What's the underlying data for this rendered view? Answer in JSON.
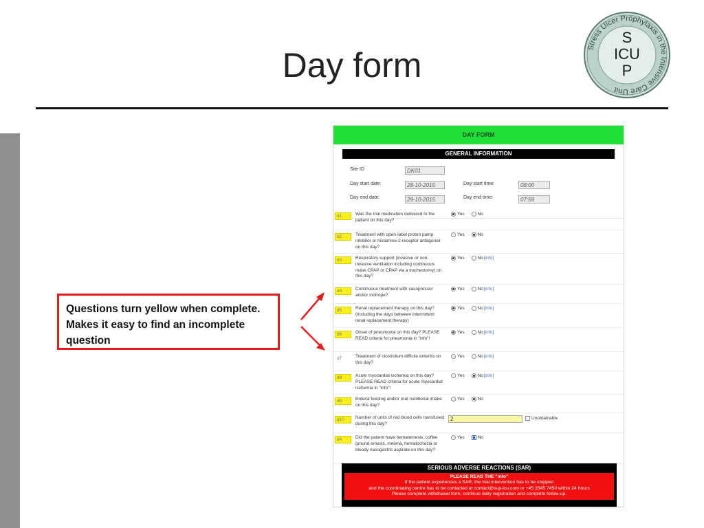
{
  "slide": {
    "title": "Day form",
    "callout": "Questions turn yellow when complete. Makes it easy to find an incomplete question"
  },
  "logo": {
    "ring_text": "Stress Ulcer Prophylaxis in the Intensive Care Unit",
    "letters": [
      "S",
      "ICU",
      "P"
    ]
  },
  "form": {
    "header": "DAY FORM",
    "general_section": "GENERAL INFORMATION",
    "general": {
      "site_id_label": "Site ID",
      "site_id": "DK01",
      "day_start_date_label": "Day start date:",
      "day_start_date": "28-10-2015",
      "day_start_time_label": "Day start time:",
      "day_start_time": "08:00",
      "day_end_date_label": "Day end date:",
      "day_end_date": "29-10-2015",
      "day_end_time_label": "Day end time:",
      "day_end_time": "07:59"
    },
    "yes_label": "Yes",
    "no_label": "No",
    "info_label": "[info]",
    "unobtainable_label": "Unobtainable",
    "questions": [
      {
        "code": "d1",
        "text": "Was the trial medication delivered to the patient on this day?",
        "answer": "yes",
        "info": false,
        "complete": true
      },
      {
        "code": "d2",
        "text": "Treatment with open-label proton pump inhibitor or histamine-2-receptor antagonist on this day?",
        "answer": "no",
        "info": false,
        "complete": true
      },
      {
        "code": "d3",
        "text": "Respiratory support (invasive or non-invasive ventilation including continuous mask CPAP or CPAP via a tracheotomy) on this day?",
        "answer": "yes",
        "info": true,
        "complete": true
      },
      {
        "code": "d4",
        "text": "Continuous treatment with vasopressor and/or inotrope?",
        "answer": "yes",
        "info": true,
        "complete": true
      },
      {
        "code": "d5",
        "text": "Renal replacement therapy on this day? (Including the days between intermittent renal replacement therapy)",
        "answer": "yes",
        "info": true,
        "complete": true
      },
      {
        "code": "d6",
        "text": "Onset of pneumonia on this day? PLEASE READ criteria for pneumonia in \"info\"!",
        "answer": "yes",
        "info": true,
        "complete": true
      },
      {
        "code": "d7",
        "text": "Treatment of clostridium difficile enteritis on this day?",
        "answer": "",
        "info": true,
        "complete": false
      },
      {
        "code": "d8",
        "text": "Acute myocardial ischemia on this day? PLEASE READ criteria for acute myocardial ischemia in \"info\"!",
        "answer": "no",
        "info": true,
        "complete": true
      },
      {
        "code": "d9",
        "text": "Enteral feeding and/or oral nutritional intake on this day?",
        "answer": "no",
        "info": false,
        "complete": true
      },
      {
        "code": "d10",
        "text": "Number of units of red blood cells transfused during this day?",
        "input": "2",
        "complete": true
      },
      {
        "code": "d4",
        "text": "Did the patient have hematemesis, coffee ground emesis, melena, hematochezia or bloody nasogastric aspirate on this day?",
        "answer": "no",
        "info": false,
        "complete": true,
        "square": true
      }
    ],
    "sar": {
      "title": "SERIOUS ADVERSE REACTIONS (SAR)",
      "line1": "PLEASE READ THE \"info\"",
      "line2": "If the patient experiences a SAR, the trial intervention has to be stopped",
      "line3": "and the coordinating centre has to be contacted at contact@sup-icu.com or +45 3545 7450 within 24 hours",
      "line4": "Please complete withdrawal form, continue daily registration and complete follow-up."
    }
  }
}
